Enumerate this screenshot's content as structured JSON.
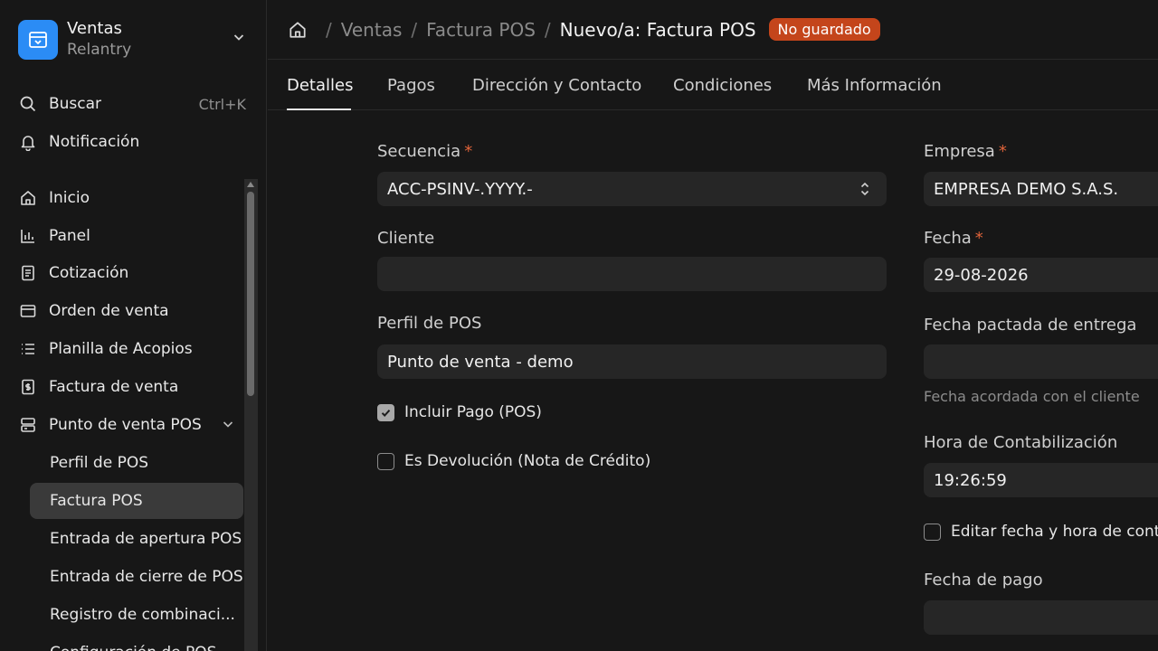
{
  "app": {
    "name": "Ventas",
    "subtitle": "Relantry"
  },
  "sidebar": {
    "search": {
      "label": "Buscar",
      "shortcut": "Ctrl+K"
    },
    "notifications": {
      "label": "Notificación"
    },
    "items": [
      {
        "label": "Inicio",
        "icon": "home-icon"
      },
      {
        "label": "Panel",
        "icon": "bar-chart-icon"
      },
      {
        "label": "Cotización",
        "icon": "document-icon"
      },
      {
        "label": "Orden de venta",
        "icon": "card-icon"
      },
      {
        "label": "Planilla de Acopios",
        "icon": "list-icon"
      },
      {
        "label": "Factura de venta",
        "icon": "invoice-icon"
      },
      {
        "label": "Punto de venta POS",
        "icon": "pos-icon"
      }
    ],
    "subitems": [
      {
        "label": "Perfil de POS"
      },
      {
        "label": "Factura POS"
      },
      {
        "label": "Entrada de apertura POS"
      },
      {
        "label": "Entrada de cierre de POS"
      },
      {
        "label": "Registro de combinaci..."
      },
      {
        "label": "Configuración de POS"
      }
    ]
  },
  "breadcrumb": {
    "items": [
      "Ventas",
      "Factura POS"
    ],
    "current": "Nuevo/a: Factura POS",
    "status_badge": "No guardado"
  },
  "tabs": [
    "Detalles",
    "Pagos",
    "Dirección y Contacto",
    "Condiciones",
    "Más Información"
  ],
  "form": {
    "secuencia": {
      "label": "Secuencia",
      "value": "ACC-PSINV-.YYYY.-"
    },
    "cliente": {
      "label": "Cliente",
      "value": ""
    },
    "perfil_pos": {
      "label": "Perfil de POS",
      "value": "Punto de venta - demo"
    },
    "incluir_pago": {
      "label": "Incluir Pago (POS)",
      "checked": true
    },
    "es_devolucion": {
      "label": "Es Devolución (Nota de Crédito)",
      "checked": false
    },
    "empresa": {
      "label": "Empresa",
      "value": "EMPRESA DEMO S.A.S."
    },
    "fecha": {
      "label": "Fecha",
      "value": "29-08-2026"
    },
    "fecha_entrega": {
      "label": "Fecha pactada de entrega",
      "value": "",
      "help": "Fecha acordada con el cliente"
    },
    "hora": {
      "label": "Hora de Contabilización",
      "value": "19:26:59"
    },
    "editar_fecha": {
      "label": "Editar fecha y hora de cont",
      "checked": false
    },
    "fecha_pago": {
      "label": "Fecha de pago",
      "value": ""
    },
    "required_mark": "*"
  },
  "colors": {
    "accent": "#2b8cf5",
    "badge": "#c4451b",
    "required": "#e0643a"
  }
}
